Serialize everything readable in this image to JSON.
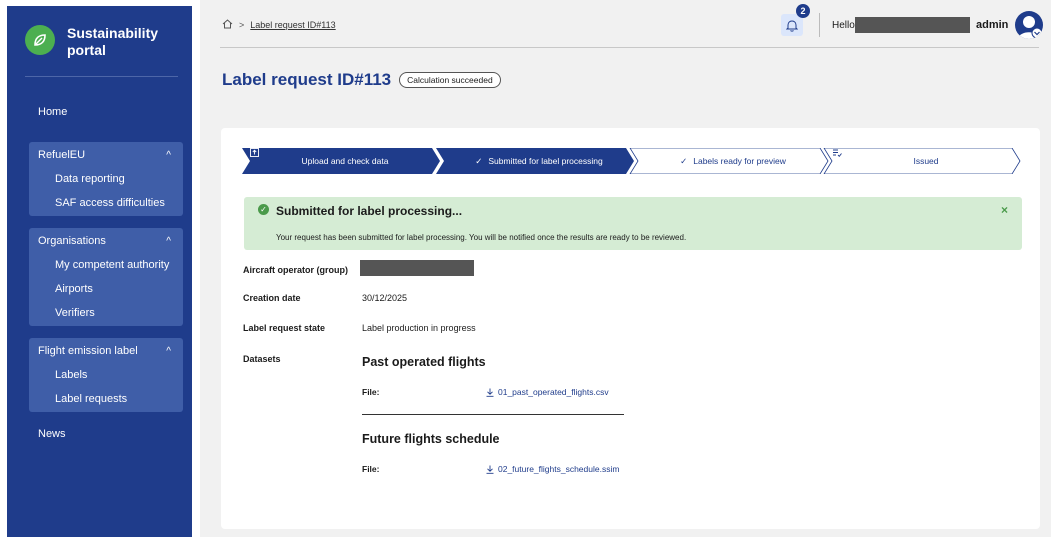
{
  "app": {
    "brand_name": "Sustainability portal"
  },
  "sidebar": {
    "home": "Home",
    "groups": [
      {
        "label": "RefuelEU",
        "items": [
          "Data reporting",
          "SAF access difficulties"
        ]
      },
      {
        "label": "Organisations",
        "items": [
          "My competent authority",
          "Airports",
          "Verifiers"
        ]
      },
      {
        "label": "Flight emission label",
        "items": [
          "Labels",
          "Label requests"
        ]
      }
    ],
    "news": "News"
  },
  "topbar": {
    "breadcrumb_separator": ">",
    "breadcrumb_current": "Label request ID#113",
    "notification_count": "2",
    "greeting": "Hello",
    "role": "admin"
  },
  "page": {
    "title": "Label request ID#113",
    "status_badge": "Calculation succeeded"
  },
  "stepper": {
    "steps": [
      {
        "label": "Upload and check data",
        "icon": "upload-icon",
        "state": "done"
      },
      {
        "label": "Submitted for label processing",
        "icon": "check-icon",
        "state": "done"
      },
      {
        "label": "Labels ready for preview",
        "icon": "check-icon",
        "state": "todo"
      },
      {
        "label": "Issued",
        "icon": "issued-icon",
        "state": "todo"
      }
    ]
  },
  "alert": {
    "title": "Submitted for label processing...",
    "body": "Your request has been submitted for label processing. You will be notified once the results are ready to be reviewed."
  },
  "details": {
    "operator_label": "Aircraft operator (group)",
    "creation_date_label": "Creation date",
    "creation_date_value": "30/12/2025",
    "state_label": "Label request state",
    "state_value": "Label production in progress",
    "datasets_label": "Datasets"
  },
  "datasets": [
    {
      "title": "Past operated flights",
      "file_label": "File:",
      "file_name": "01_past_operated_flights.csv"
    },
    {
      "title": "Future flights schedule",
      "file_label": "File:",
      "file_name": "02_future_flights_schedule.ssim"
    }
  ],
  "colors": {
    "primary": "#1f3c8b",
    "sidebar_group": "#3f5ea8",
    "success_bg": "#d5ecd4",
    "success": "#4a9a4a",
    "page_bg": "#f1f1f1"
  }
}
